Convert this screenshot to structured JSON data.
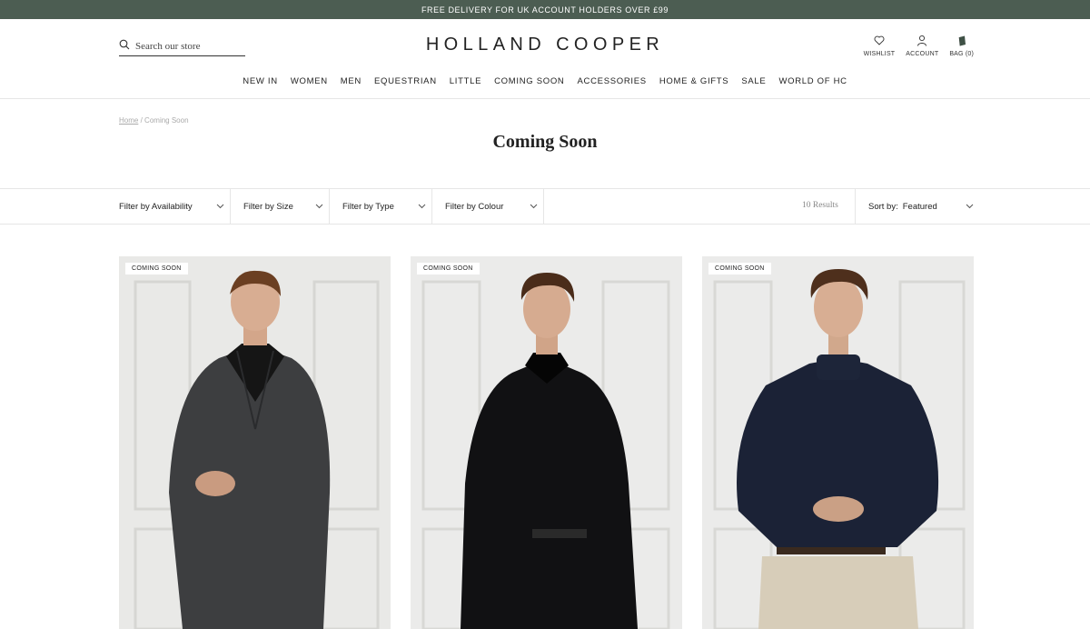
{
  "promo": {
    "text": "FREE DELIVERY FOR UK ACCOUNT HOLDERS OVER £99"
  },
  "header": {
    "search_placeholder": "Search our store",
    "logo": "HOLLAND COOPER",
    "utils": {
      "wishlist": "WISHLIST",
      "account": "ACCOUNT",
      "bag": "BAG (0)"
    }
  },
  "nav": [
    "NEW IN",
    "WOMEN",
    "MEN",
    "EQUESTRIAN",
    "LITTLE",
    "COMING SOON",
    "ACCESSORIES",
    "HOME & GIFTS",
    "SALE",
    "WORLD OF HC"
  ],
  "breadcrumb": {
    "home": "Home",
    "separator": "/",
    "current": "Coming Soon"
  },
  "page_title": "Coming Soon",
  "filters": [
    "Filter by Availability",
    "Filter by Size",
    "Filter by Type",
    "Filter by Colour"
  ],
  "results": "10 Results",
  "sort": {
    "label": "Sort by:",
    "value": "Featured"
  },
  "products": [
    {
      "badge": "COMING SOON",
      "image": "man in grey double-breasted overcoat with black roll neck"
    },
    {
      "badge": "COMING SOON",
      "image": "man in black double-breasted coat with black roll neck"
    },
    {
      "badge": "COMING SOON",
      "image": "man in navy roll neck jumper with stone trousers"
    }
  ],
  "colors": {
    "promo_bg": "#4c5d52",
    "text": "#222222",
    "border": "#e6e6e6"
  }
}
